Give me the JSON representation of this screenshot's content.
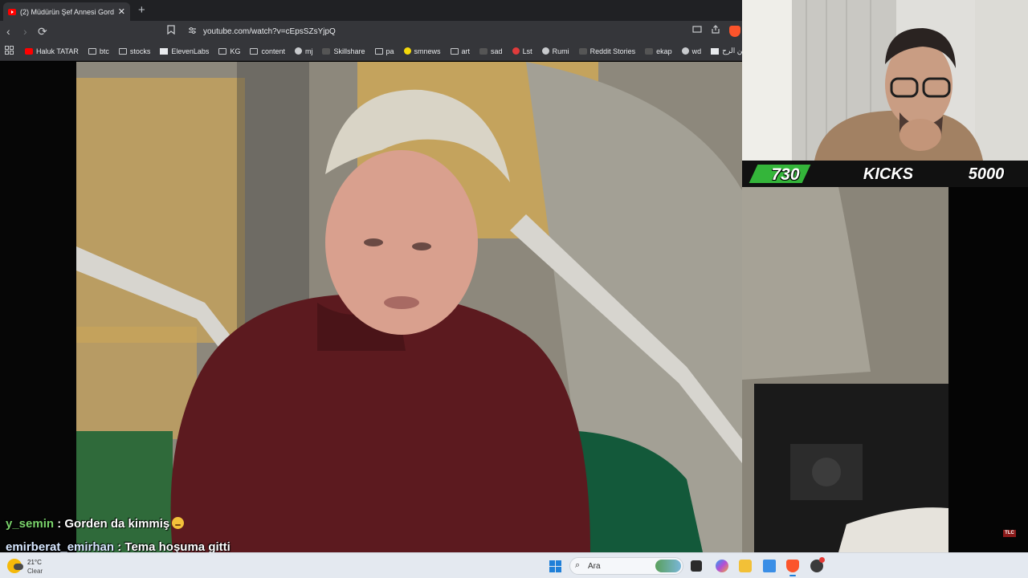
{
  "browser": {
    "tab": {
      "title": "(2) Müdürün Şef Annesi Gord",
      "close": "✕"
    },
    "new_tab": "+",
    "nav": {
      "back": "‹",
      "forward": "›",
      "reload": "⟳"
    },
    "url": "youtube.com/watch?v=cEpsSZsYjpQ",
    "icons": [
      "bookmark-icon",
      "site-info-icon",
      "cast-icon",
      "share-icon",
      "brave-icon"
    ]
  },
  "bookmarks": [
    {
      "label": "Haluk TATAR",
      "icon": "youtube"
    },
    {
      "label": "btc",
      "icon": "folder"
    },
    {
      "label": "stocks",
      "icon": "folder"
    },
    {
      "label": "ElevenLabs",
      "icon": "doc"
    },
    {
      "label": "KG",
      "icon": "folder"
    },
    {
      "label": "content",
      "icon": "folder"
    },
    {
      "label": "mj",
      "icon": "github"
    },
    {
      "label": "Skillshare",
      "icon": "dark"
    },
    {
      "label": "pa",
      "icon": "folder"
    },
    {
      "label": "smnews",
      "icon": "yellow"
    },
    {
      "label": "art",
      "icon": "folder"
    },
    {
      "label": "sad",
      "icon": "dark"
    },
    {
      "label": "Lst",
      "icon": "red"
    },
    {
      "label": "Rumi",
      "icon": "round"
    },
    {
      "label": "Reddit Stories",
      "icon": "dark"
    },
    {
      "label": "ekap",
      "icon": "dark"
    },
    {
      "label": "wd",
      "icon": "round"
    },
    {
      "label": "الرحمن الرح...",
      "icon": "doc"
    }
  ],
  "goal": {
    "current": "730",
    "label": "KICKS",
    "target": "5000",
    "progress": 0.146,
    "fill_color": "#34b53a"
  },
  "chat": [
    {
      "user": "y_semin",
      "message": ": Gorden da kimmiş",
      "user_color": "#7ad36b",
      "emoji": "smirking-face"
    },
    {
      "user": "emirberat_emirhan",
      "message": ": Tema hoşuma gitti",
      "user_color": "#d7e7ff"
    }
  ],
  "watermark": "TLC",
  "taskbar": {
    "temperature": "21°C",
    "condition": "Clear",
    "search_placeholder": "Ara",
    "apps": [
      "task-view",
      "copilot",
      "file-explorer",
      "snipping-tool",
      "brave-browser",
      "other-app"
    ]
  }
}
